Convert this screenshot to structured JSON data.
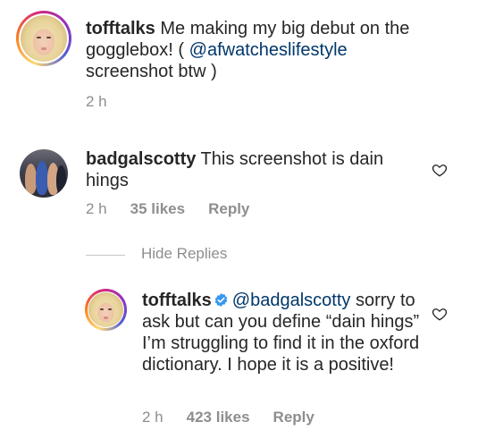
{
  "caption": {
    "username": "tofftalks",
    "text_part1": " Me making my big debut on the gogglebox! ( ",
    "mention": "@afwatcheslifestyle",
    "text_part2": " screenshot btw )",
    "time": "2 h"
  },
  "comment1": {
    "username": "badgalscotty",
    "text": " This screenshot is dain hings",
    "time": "2 h",
    "likes": "35 likes",
    "reply": "Reply"
  },
  "replies_toggle": {
    "label": "Hide Replies"
  },
  "reply1": {
    "username": "tofftalks",
    "mention": "@badgalscotty",
    "text": " sorry to ask but can you define “dain hings” I’m struggling to find it in the oxford dictionary. I hope it is a positive!",
    "time": "2 h",
    "likes": "423 likes",
    "reply": "Reply"
  },
  "icons": {
    "heart": "heart-icon",
    "verified": "verified-badge-icon"
  },
  "colors": {
    "text": "#262626",
    "meta": "#8e8e8e",
    "mention": "#00376b",
    "verified": "#3897f0"
  }
}
